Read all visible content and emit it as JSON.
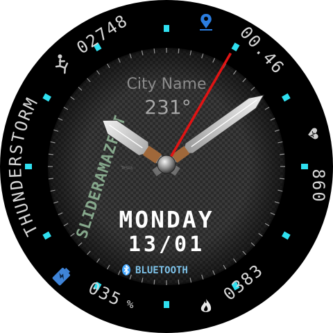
{
  "weather": {
    "city": "City Name",
    "temperature": "231°",
    "condition": "THUNDERSTORM"
  },
  "date": {
    "weekday": "MONDAY",
    "day_month": "13/01"
  },
  "connectivity": {
    "bluetooth_label": "BLUETOOTH"
  },
  "brand": {
    "name": "SLIDERAMAZFIT",
    "badge": "Tesla"
  },
  "complications": {
    "steps": "02748",
    "distance": "00.46",
    "heart_rate": "860",
    "calories": "0383",
    "battery": "035",
    "battery_unit": "%"
  },
  "time": {
    "hour": 10,
    "minute": 9,
    "second": 5
  },
  "colors": {
    "accent_cyan": "#2fe0f0",
    "second_hand": "#e01414",
    "location_pin": "#2b7de0",
    "battery_icon": "#3f84d8",
    "calories_icon": "#ff8a2a",
    "bluetooth": "#3fa5ff"
  },
  "icons": [
    "runner-icon",
    "location-pin-icon",
    "heart-icon",
    "fire-icon",
    "battery-icon",
    "bluetooth-icon"
  ]
}
